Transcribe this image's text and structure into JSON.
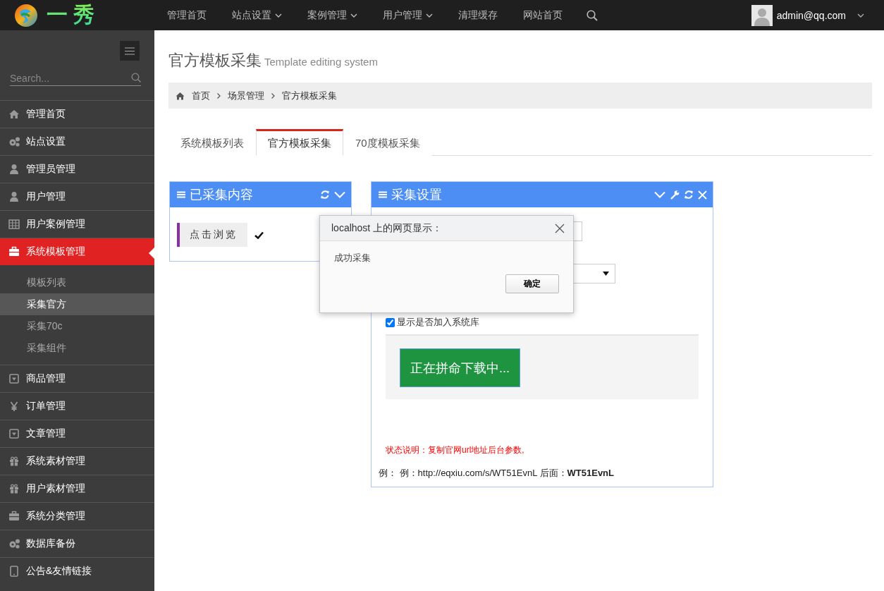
{
  "logo": {
    "text": "一秀"
  },
  "top_nav": [
    {
      "label": "管理首页",
      "dropdown": false
    },
    {
      "label": "站点设置",
      "dropdown": true
    },
    {
      "label": "案例管理",
      "dropdown": true
    },
    {
      "label": "用户管理",
      "dropdown": true
    },
    {
      "label": "清理缓存",
      "dropdown": false
    },
    {
      "label": "网站首页",
      "dropdown": false
    }
  ],
  "user": {
    "name": "admin@qq.com"
  },
  "sidebar": {
    "search": {
      "placeholder": "Search..."
    },
    "items": [
      {
        "label": "管理首页",
        "kind": "home",
        "selected": false
      },
      {
        "label": "站点设置",
        "kind": "gears",
        "selected": false
      },
      {
        "label": "管理员管理",
        "kind": "user",
        "selected": false
      },
      {
        "label": "用户管理",
        "kind": "user",
        "selected": false
      },
      {
        "label": "用户案例管理",
        "kind": "table",
        "selected": false
      },
      {
        "label": "系统模板管理",
        "kind": "briefcase",
        "selected": true,
        "expanded": true,
        "children": [
          {
            "label": "模板列表",
            "selected": false
          },
          {
            "label": "采集官方",
            "selected": true
          },
          {
            "label": "采集70c",
            "selected": false
          },
          {
            "label": "采集组件",
            "selected": false
          }
        ]
      },
      {
        "label": "商品管理",
        "kind": "caret-square",
        "selected": false
      },
      {
        "label": "订单管理",
        "kind": "yen",
        "selected": false
      },
      {
        "label": "文章管理",
        "kind": "caret-square",
        "selected": false
      },
      {
        "label": "系统素材管理",
        "kind": "gift",
        "selected": false
      },
      {
        "label": "用户素材管理",
        "kind": "gift",
        "selected": false
      },
      {
        "label": "系统分类管理",
        "kind": "briefcase",
        "selected": false
      },
      {
        "label": "数据库备份",
        "kind": "gears",
        "selected": false
      },
      {
        "label": "公告&友情链接",
        "kind": "tablet",
        "selected": false
      }
    ]
  },
  "page": {
    "title": "官方模板采集",
    "subtitle": "Template editing system"
  },
  "breadcrumb": [
    "首页",
    "场景管理",
    "官方模板采集"
  ],
  "tabs": [
    {
      "label": "系统模板列表",
      "selected": false
    },
    {
      "label": "官方模板采集",
      "selected": true
    },
    {
      "label": "70度模板采集",
      "selected": false
    }
  ],
  "collected_panel": {
    "title": "已采集内容",
    "browse_button": "点击浏览",
    "done": true
  },
  "settings_panel": {
    "title": "采集设置",
    "checkbox": {
      "label": "显示是否加入系统库",
      "checked": true
    },
    "download_button": "正在拼命下载中...",
    "status_note": "状态说明：复制官网url地址后台参数,",
    "example": "例： 例：http://eqxiu.com/s/WT51EvnL 后面：**WT51EvnL**"
  },
  "dialog": {
    "title": "localhost 上的网页显示：",
    "message": "成功采集",
    "ok_button": "确定"
  }
}
